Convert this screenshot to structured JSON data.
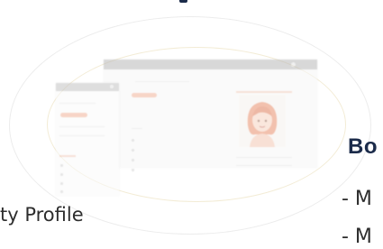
{
  "heading_partial": "Bo",
  "list_items": [
    "- M",
    "- M"
  ],
  "caption_partial": "ty Profile",
  "icons": {
    "avatar": "woman-avatar-icon"
  },
  "colors": {
    "heading": "#1b2b4a",
    "text": "#2d2d2d",
    "accent": "#f2b49a"
  }
}
